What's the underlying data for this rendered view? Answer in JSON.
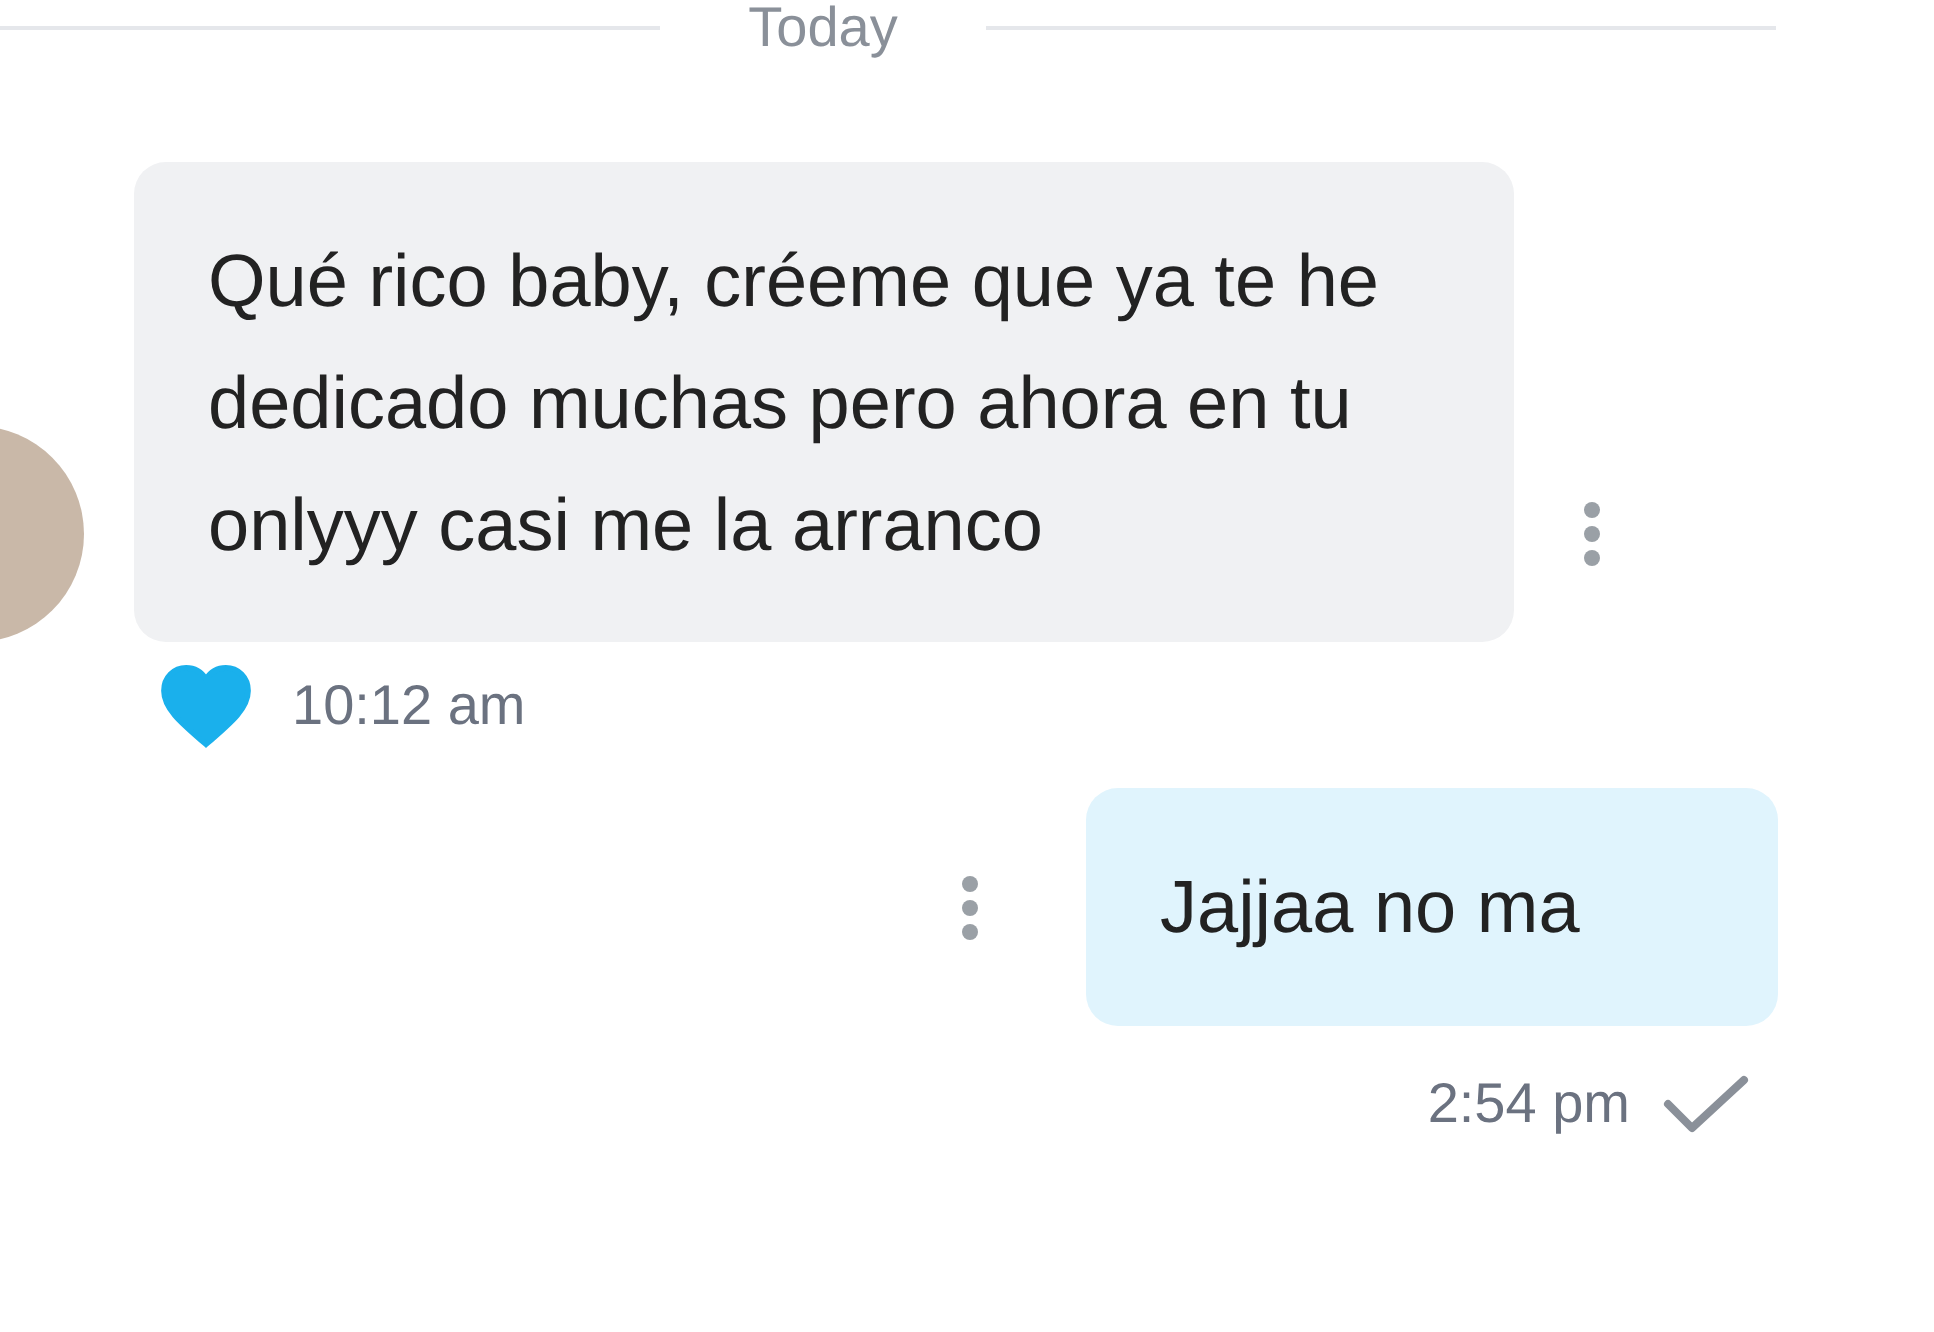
{
  "divider": {
    "label": "Today"
  },
  "messages": [
    {
      "kind": "incoming",
      "text": "Qué rico baby, créeme que ya te he dedicado muchas pero ahora en tu onlyyy casi me la arranco",
      "time": "10:12 am",
      "liked": true
    },
    {
      "kind": "outgoing",
      "text": "Jajjaa no ma",
      "time": "2:54 pm",
      "delivered": true
    }
  ]
}
